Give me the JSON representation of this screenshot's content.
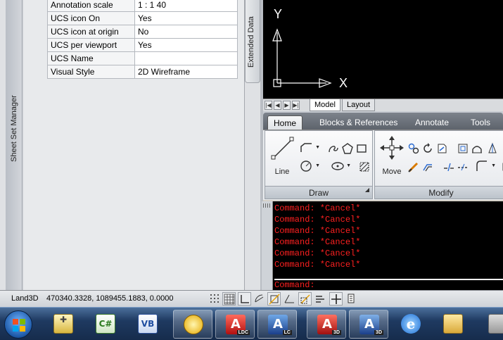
{
  "palettes": {
    "sheet_set_manager_label": "Sheet Set Manager",
    "extended_data_label": "Extended Data",
    "properties": [
      {
        "name": "Annotation scale",
        "value": "1 : 1 40"
      },
      {
        "name": "UCS icon On",
        "value": "Yes"
      },
      {
        "name": "UCS icon at origin",
        "value": "No"
      },
      {
        "name": "UCS per viewport",
        "value": "Yes"
      },
      {
        "name": "UCS Name",
        "value": ""
      },
      {
        "name": "Visual Style",
        "value": "2D Wireframe"
      }
    ]
  },
  "drawing": {
    "ucs_x_label": "X",
    "ucs_y_label": "Y",
    "tabs": [
      "Model",
      "Layout"
    ],
    "active_tab": "Model"
  },
  "ribbon": {
    "tabs": [
      "Home",
      "Blocks & References",
      "Annotate",
      "Tools"
    ],
    "active_tab": "Home",
    "draw_panel": {
      "title": "Draw",
      "line_label": "Line"
    },
    "modify_panel": {
      "title": "Modify",
      "move_label": "Move"
    }
  },
  "command_line": {
    "history": [
      "Command: *Cancel*",
      "Command: *Cancel*",
      "Command: *Cancel*",
      "Command: *Cancel*",
      "Command: *Cancel*",
      "Command: *Cancel*"
    ],
    "prompt": "Command:"
  },
  "status_bar": {
    "workspace": "Land3D",
    "coordinates": "470340.3328, 1089455.1883, 0.0000"
  },
  "taskbar": {
    "apps": [
      {
        "name": "app-1",
        "badge": ""
      },
      {
        "name": "csharp",
        "glyph": "C#",
        "badge": ""
      },
      {
        "name": "vb",
        "glyph": "VB",
        "badge": ""
      },
      {
        "name": "outlook",
        "badge": ""
      },
      {
        "name": "autocad-ldc",
        "glyph": "A",
        "badge": "LDC"
      },
      {
        "name": "autocad-lc",
        "glyph": "A",
        "badge": "LC"
      },
      {
        "name": "autocad-3d",
        "glyph": "A",
        "badge": "3D"
      },
      {
        "name": "autocad-3d-2",
        "glyph": "A",
        "badge": "3D"
      },
      {
        "name": "internet-explorer",
        "badge": ""
      },
      {
        "name": "explorer",
        "badge": ""
      }
    ]
  },
  "colors": {
    "command_text": "#ff2020",
    "canvas_bg": "#000000",
    "taskbar_bg": "#1f3a61"
  }
}
